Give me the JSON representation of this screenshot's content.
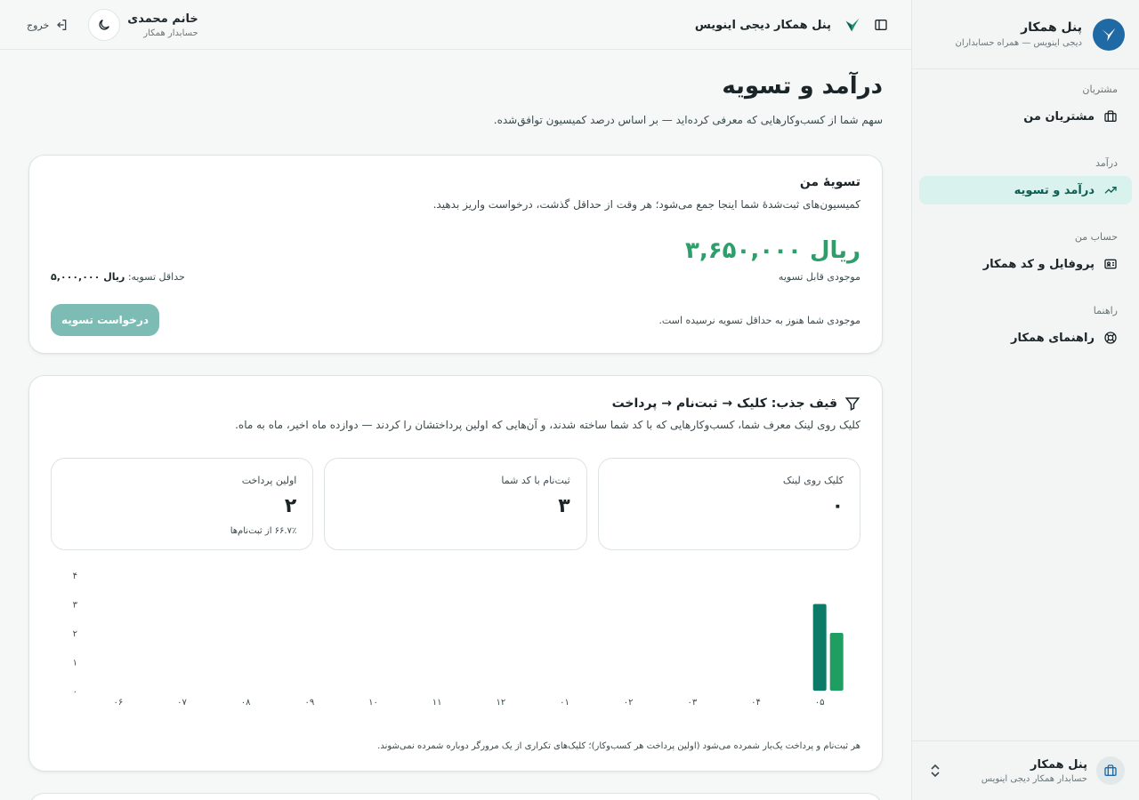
{
  "sidebar": {
    "brand_title": "پنل همکار",
    "brand_sub": "دیجی اینویس — همراه حسابداران",
    "groups": [
      {
        "label": "مشتریان",
        "items": [
          {
            "label": "مشتریان من",
            "icon": "briefcase-icon"
          }
        ]
      },
      {
        "label": "درآمد",
        "items": [
          {
            "label": "درآمد و تسویه",
            "icon": "trending-up-icon",
            "active": true
          }
        ]
      },
      {
        "label": "حساب من",
        "items": [
          {
            "label": "پروفایل و کد همکار",
            "icon": "id-card-icon"
          }
        ]
      },
      {
        "label": "راهنما",
        "items": [
          {
            "label": "راهنمای همکار",
            "icon": "lifebuoy-icon"
          }
        ]
      }
    ],
    "footer_title": "پنل همکار",
    "footer_sub": "حسابدار همکار دیجی اینویس"
  },
  "topbar": {
    "title": "پنل همکار دیجی اینویس",
    "user_name": "خانم محمدی",
    "user_role": "حسابدار همکار",
    "logout_label": "خروج"
  },
  "page": {
    "title": "درآمد و تسویه",
    "description": "سهم شما از کسب‌وکارهایی که معرفی کرده‌اید — بر اساس درصد کمیسیون توافق‌شده."
  },
  "settlement": {
    "title": "تسویهٔ من",
    "description": "کمیسیون‌های ثبت‌شدهٔ شما اینجا جمع می‌شود؛ هر وقت از حداقل گذشت، درخواست واریز بدهید.",
    "amount": "ریال ۳,۶۵۰,۰۰۰",
    "balance_label": "موجودی قابل تسویه",
    "min_label": "حداقل تسویه:",
    "min_value": "ریال ۵,۰۰۰,۰۰۰",
    "status_note": "موجودی شما هنوز به حداقل تسویه نرسیده است.",
    "button_label": "درخواست تسویه"
  },
  "funnel": {
    "title": "قیف جذب: کلیک → ثبت‌نام → پرداخت",
    "description": "کلیک روی لینک معرف شما، کسب‌وکارهایی که با کد شما ساخته شدند، و آن‌هایی که اولین پرداختشان را کردند — دوازده ماه اخیر، ماه به ماه.",
    "stats": [
      {
        "label": "کلیک روی لینک",
        "value": "۰",
        "note": ""
      },
      {
        "label": "ثبت‌نام با کد شما",
        "value": "۳",
        "note": ""
      },
      {
        "label": "اولین پرداخت",
        "value": "۲",
        "note": "۶۶.۷٪ از ثبت‌نام‌ها"
      }
    ],
    "footnote": "هر ثبت‌نام و پرداخت یک‌بار شمرده می‌شود (اولین پرداخت هر کسب‌وکار)؛ کلیک‌های تکراری از یک مرورگر دوباره شمرده نمی‌شوند."
  },
  "chart_data": {
    "type": "bar",
    "categories": [
      "۰۶",
      "۰۷",
      "۰۸",
      "۰۹",
      "۱۰",
      "۱۱",
      "۱۲",
      "۰۱",
      "۰۲",
      "۰۳",
      "۰۴",
      "۰۵"
    ],
    "series": [
      {
        "values": [
          0,
          0,
          0,
          0,
          0,
          0,
          0,
          0,
          0,
          0,
          0,
          0
        ],
        "color": "#16a394"
      },
      {
        "values": [
          0,
          0,
          0,
          0,
          0,
          0,
          0,
          0,
          0,
          0,
          0,
          3
        ],
        "color": "#0b7a66"
      },
      {
        "values": [
          0,
          0,
          0,
          0,
          0,
          0,
          0,
          0,
          0,
          0,
          0,
          2
        ],
        "color": "#1f9e62"
      }
    ],
    "y_ticks": [
      "۰",
      "۱",
      "۲",
      "۳",
      "۴"
    ],
    "ylim": [
      0,
      4
    ],
    "grid": false
  },
  "colors": {
    "accent": "#0f5e52",
    "amount": "#2e9e6a",
    "button_disabled": "#7dbcb4",
    "logo": "#1f6aa5"
  }
}
